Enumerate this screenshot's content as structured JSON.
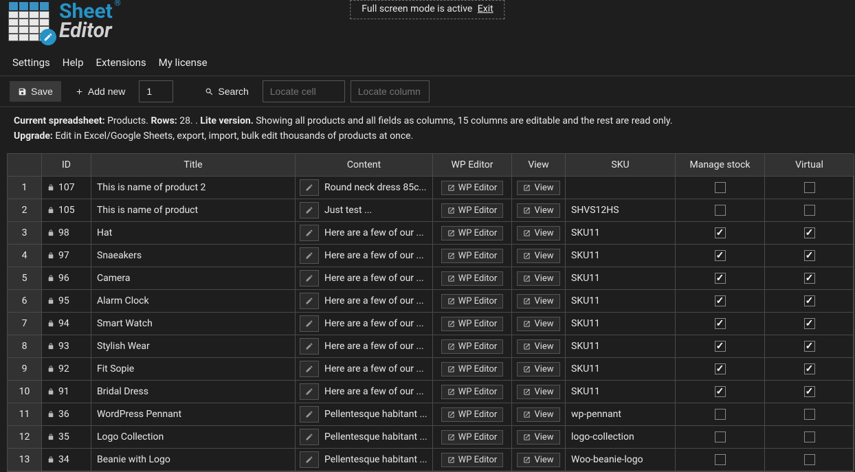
{
  "banner": {
    "text": "Full screen mode is active",
    "exit": "Exit"
  },
  "logo": {
    "word1": "Sheet",
    "word2": "Editor",
    "reg": "®"
  },
  "menu": {
    "settings": "Settings",
    "help": "Help",
    "extensions": "Extensions",
    "license": "My license"
  },
  "toolbar": {
    "save": "Save",
    "add_new": "Add new",
    "page_num": "1",
    "search": "Search",
    "locate_cell_ph": "Locate cell",
    "locate_col_ph": "Locate column"
  },
  "info": {
    "label_current": "Current spreadsheet:",
    "spreadsheet": "Products.",
    "label_rows": "Rows:",
    "rows": "28. .",
    "lite": "Lite version.",
    "desc": "Showing all products and all fields as columns, 15 columns are editable and the rest are read only.",
    "label_upgrade": "Upgrade:",
    "upgrade_desc": "Edit in Excel/Google Sheets, export, import, bulk edit thousands of products at once."
  },
  "columns": {
    "id": "ID",
    "title": "Title",
    "content": "Content",
    "wp_editor": "WP Editor",
    "view": "View",
    "sku": "SKU",
    "manage_stock": "Manage stock",
    "virtual": "Virtual"
  },
  "buttons": {
    "wp_editor": "WP Editor",
    "view": "View"
  },
  "rows": [
    {
      "n": "1",
      "id": "107",
      "title": "This is name of product 2",
      "content": "Round neck dress 85c...",
      "sku": "",
      "ms": false,
      "v": false
    },
    {
      "n": "2",
      "id": "105",
      "title": "This is name of product",
      "content": "Just test ...",
      "sku": "SHVS12HS",
      "ms": false,
      "v": false
    },
    {
      "n": "3",
      "id": "98",
      "title": "Hat",
      "content": "Here are a few of our ...",
      "sku": "SKU11",
      "ms": true,
      "v": true
    },
    {
      "n": "4",
      "id": "97",
      "title": "Snaeakers",
      "content": "Here are a few of our ...",
      "sku": "SKU11",
      "ms": true,
      "v": true
    },
    {
      "n": "5",
      "id": "96",
      "title": "Camera",
      "content": "Here are a few of our ...",
      "sku": "SKU11",
      "ms": true,
      "v": true
    },
    {
      "n": "6",
      "id": "95",
      "title": "Alarm Clock",
      "content": "Here are a few of our ...",
      "sku": "SKU11",
      "ms": true,
      "v": true
    },
    {
      "n": "7",
      "id": "94",
      "title": "Smart Watch",
      "content": "Here are a few of our ...",
      "sku": "SKU11",
      "ms": true,
      "v": true
    },
    {
      "n": "8",
      "id": "93",
      "title": "Stylish Wear",
      "content": "Here are a few of our ...",
      "sku": "SKU11",
      "ms": true,
      "v": true
    },
    {
      "n": "9",
      "id": "92",
      "title": "Fit Sopie",
      "content": "Here are a few of our ...",
      "sku": "SKU11",
      "ms": true,
      "v": true
    },
    {
      "n": "10",
      "id": "91",
      "title": "Bridal Dress",
      "content": "Here are a few of our ...",
      "sku": "SKU11",
      "ms": true,
      "v": true
    },
    {
      "n": "11",
      "id": "36",
      "title": "WordPress Pennant",
      "content": "Pellentesque habitant ...",
      "sku": "wp-pennant",
      "ms": false,
      "v": false
    },
    {
      "n": "12",
      "id": "35",
      "title": "Logo Collection",
      "content": "Pellentesque habitant ...",
      "sku": "logo-collection",
      "ms": false,
      "v": false
    },
    {
      "n": "13",
      "id": "34",
      "title": "Beanie with Logo",
      "content": "Pellentesque habitant ...",
      "sku": "Woo-beanie-logo",
      "ms": false,
      "v": false
    }
  ]
}
